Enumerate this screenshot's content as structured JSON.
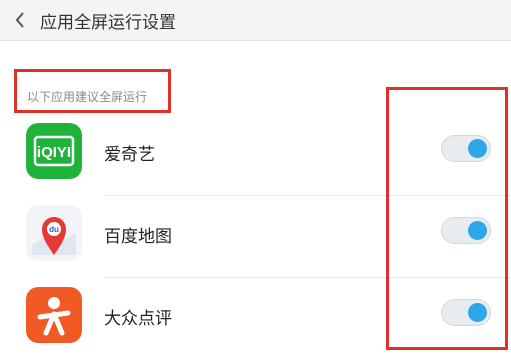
{
  "header": {
    "title": "应用全屏运行设置"
  },
  "section": {
    "label": "以下应用建议全屏运行"
  },
  "apps": [
    {
      "name": "爱奇艺",
      "icon": "iqiyi-icon",
      "enabled": true
    },
    {
      "name": "百度地图",
      "icon": "baidu-map-icon",
      "enabled": true
    },
    {
      "name": "大众点评",
      "icon": "dianping-icon",
      "enabled": true
    }
  ],
  "colors": {
    "accent": "#2ea7e8",
    "annotation": "#e0302a",
    "iqiyi": "#1fb33b",
    "dianping": "#f15a24"
  }
}
